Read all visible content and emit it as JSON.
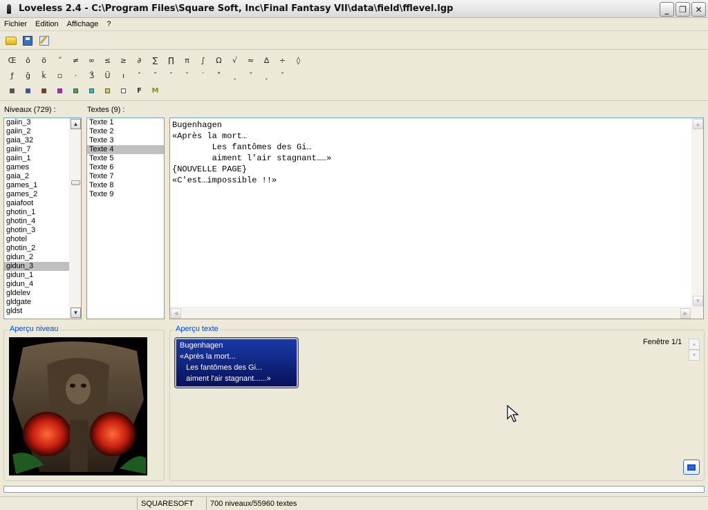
{
  "window": {
    "title": "Loveless 2.4 - C:\\Program Files\\Square Soft, Inc\\Final Fantasy VII\\data\\field\\fflevel.lgp",
    "minimize": "_",
    "restore": "❐",
    "close": "✕"
  },
  "menu": [
    "Fichier",
    "Edition",
    "Affichage",
    "?"
  ],
  "toolbar": {
    "icons": [
      "open-folder-icon",
      "save-disk-icon",
      "edit-icon"
    ]
  },
  "chars": {
    "row1": [
      "Œ",
      "ō",
      "ö",
      "˝",
      "≠",
      "∞",
      "≤",
      "≥",
      "∂",
      "∑",
      "∏",
      "π",
      "∫",
      "Ω",
      "√",
      "≈",
      "∆",
      "÷",
      "◊"
    ],
    "row2": [
      "ƒ",
      "ǧ",
      "ǩ",
      "▫",
      "·",
      "Ǯ",
      "Ü",
      "ı",
      "ˆ",
      "˜",
      "¯",
      "˘",
      "˙",
      "˚",
      "¸",
      "˝",
      "˛",
      "ˇ"
    ],
    "colors": [
      "#555555",
      "#1a5ec8",
      "#c81818",
      "#d010d0",
      "#20c020",
      "#10c8d0",
      "#e8d010",
      "#ffffff"
    ],
    "special": [
      "F",
      "M"
    ]
  },
  "levels": {
    "label": "Niveaux (729) :",
    "items": [
      "gaiin_3",
      "gaiin_2",
      "gaia_32",
      "gaiin_7",
      "gaiin_1",
      "games",
      "gaia_2",
      "games_1",
      "games_2",
      "gaiafoot",
      "ghotin_1",
      "ghotin_4",
      "ghotin_3",
      "ghotel",
      "ghotin_2",
      "gidun_2",
      "gidun_3",
      "gidun_1",
      "gidun_4",
      "gldelev",
      "gldgate",
      "gldst"
    ],
    "selected_index": 16
  },
  "texts": {
    "label": "Textes (9) :",
    "items": [
      "Texte 1",
      "Texte 2",
      "Texte 3",
      "Texte 4",
      "Texte 5",
      "Texte 6",
      "Texte 7",
      "Texte 8",
      "Texte 9"
    ],
    "selected_index": 3
  },
  "editor": {
    "lines": [
      "Bugenhagen",
      "«Après la mort…",
      "        Les fantômes des Gi…",
      "        aiment l'air stagnant……»",
      "{NOUVELLE PAGE}",
      "«C'est…impossible !!»"
    ]
  },
  "level_preview": {
    "title": "Aperçu niveau"
  },
  "text_preview": {
    "title": "Aperçu texte",
    "window_label": "Fenêtre 1/1",
    "dialog_lines": [
      "Bugenhagen",
      "«Après la mort...",
      "   Les fantômes des Gi...",
      "   aiment l'air stagnant......»"
    ]
  },
  "status": {
    "cell1": "",
    "cell2": "SQUARESOFT",
    "cell3": "700 niveaux/55960 textes"
  }
}
